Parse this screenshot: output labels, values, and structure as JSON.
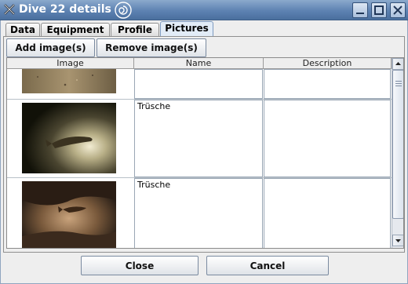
{
  "window": {
    "title": "Dive 22 details",
    "controls": [
      "minimize-icon",
      "maximize-icon",
      "close-icon"
    ]
  },
  "tabs": [
    {
      "label": "Data",
      "active": false
    },
    {
      "label": "Equipment",
      "active": false
    },
    {
      "label": "Profile",
      "active": false
    },
    {
      "label": "Pictures",
      "active": true
    }
  ],
  "toolbar": {
    "add_label": "Add image(s)",
    "remove_label": "Remove image(s)"
  },
  "table": {
    "columns": [
      "Image",
      "Name",
      "Description"
    ],
    "rows": [
      {
        "image": "sandy-bottom-photo",
        "name": "",
        "description": ""
      },
      {
        "image": "fish-on-bottom-photo",
        "name": "Trüsche",
        "description": ""
      },
      {
        "image": "fish-under-rock-photo",
        "name": "Trüsche",
        "description": ""
      }
    ]
  },
  "footer": {
    "close_label": "Close",
    "cancel_label": "Cancel"
  },
  "colors": {
    "titlebar": "#5d82b2",
    "active_tab": "#e2ecf7",
    "window_bg": "#eeeeee"
  }
}
